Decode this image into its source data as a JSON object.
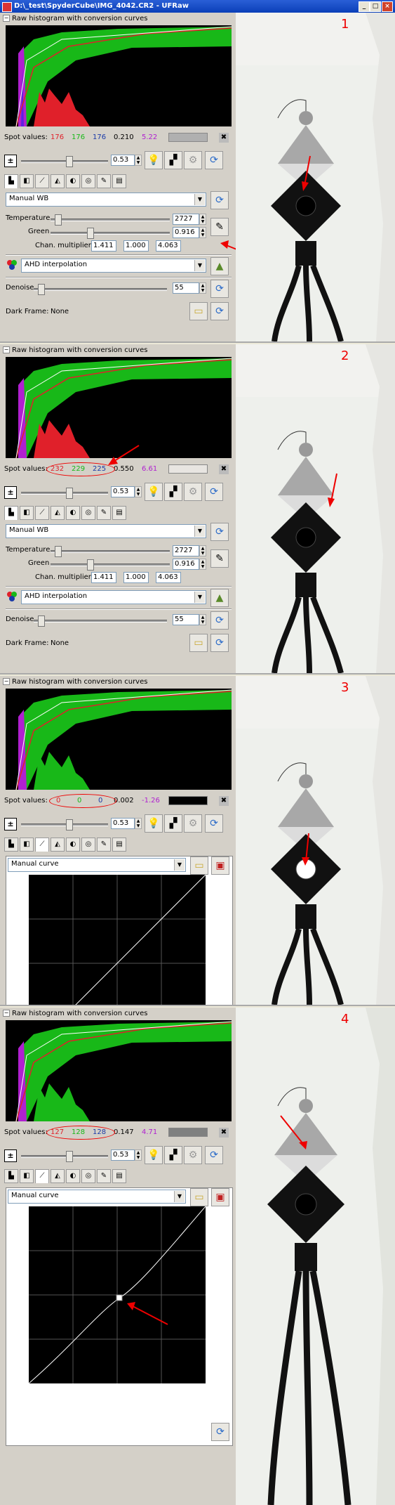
{
  "window": {
    "title": "D:\\_test\\SpyderCube\\IMG_4042.CR2 - UFRaw",
    "min_label": "_",
    "max_label": "□",
    "close_label": "×"
  },
  "panel_header": "Raw histogram with conversion curves",
  "spot_label": "Spot values:",
  "exposure_value": "0.53",
  "wb_preset": "Manual WB",
  "temperature_label": "Temperature",
  "temperature_value": "2727",
  "green_label": "Green",
  "green_value": "0.916",
  "chan_label": "Chan. multipliers:",
  "chan_values": [
    "1.411",
    "1.000",
    "4.063"
  ],
  "interpolation": "AHD interpolation",
  "denoise_label": "Denoise",
  "denoise_value": "55",
  "darkframe_label": "Dark Frame:",
  "darkframe_value": "None",
  "curve_preset": "Manual curve",
  "screens": [
    {
      "number": "1",
      "spot": {
        "r": "176",
        "g": "176",
        "b": "176",
        "lum": "0.210",
        "ev": "5.22"
      },
      "swatch": "#b0b0b0"
    },
    {
      "number": "2",
      "spot": {
        "r": "232",
        "g": "229",
        "b": "225",
        "lum": "0.550",
        "ev": "6.61"
      },
      "swatch": "#e8e5e1"
    },
    {
      "number": "3",
      "spot": {
        "r": "0",
        "g": "0",
        "b": "0",
        "lum": "0.002",
        "ev": "-1.26"
      },
      "swatch": "#000000"
    },
    {
      "number": "4",
      "spot": {
        "r": "127",
        "g": "128",
        "b": "128",
        "lum": "0.147",
        "ev": "4.71"
      },
      "swatch": "#7f8080"
    }
  ],
  "colors": {
    "red": "#e0202a",
    "green": "#18b818",
    "blue": "#1a3aa8",
    "magenta": "#b020d0",
    "annotation": "#e00000"
  }
}
